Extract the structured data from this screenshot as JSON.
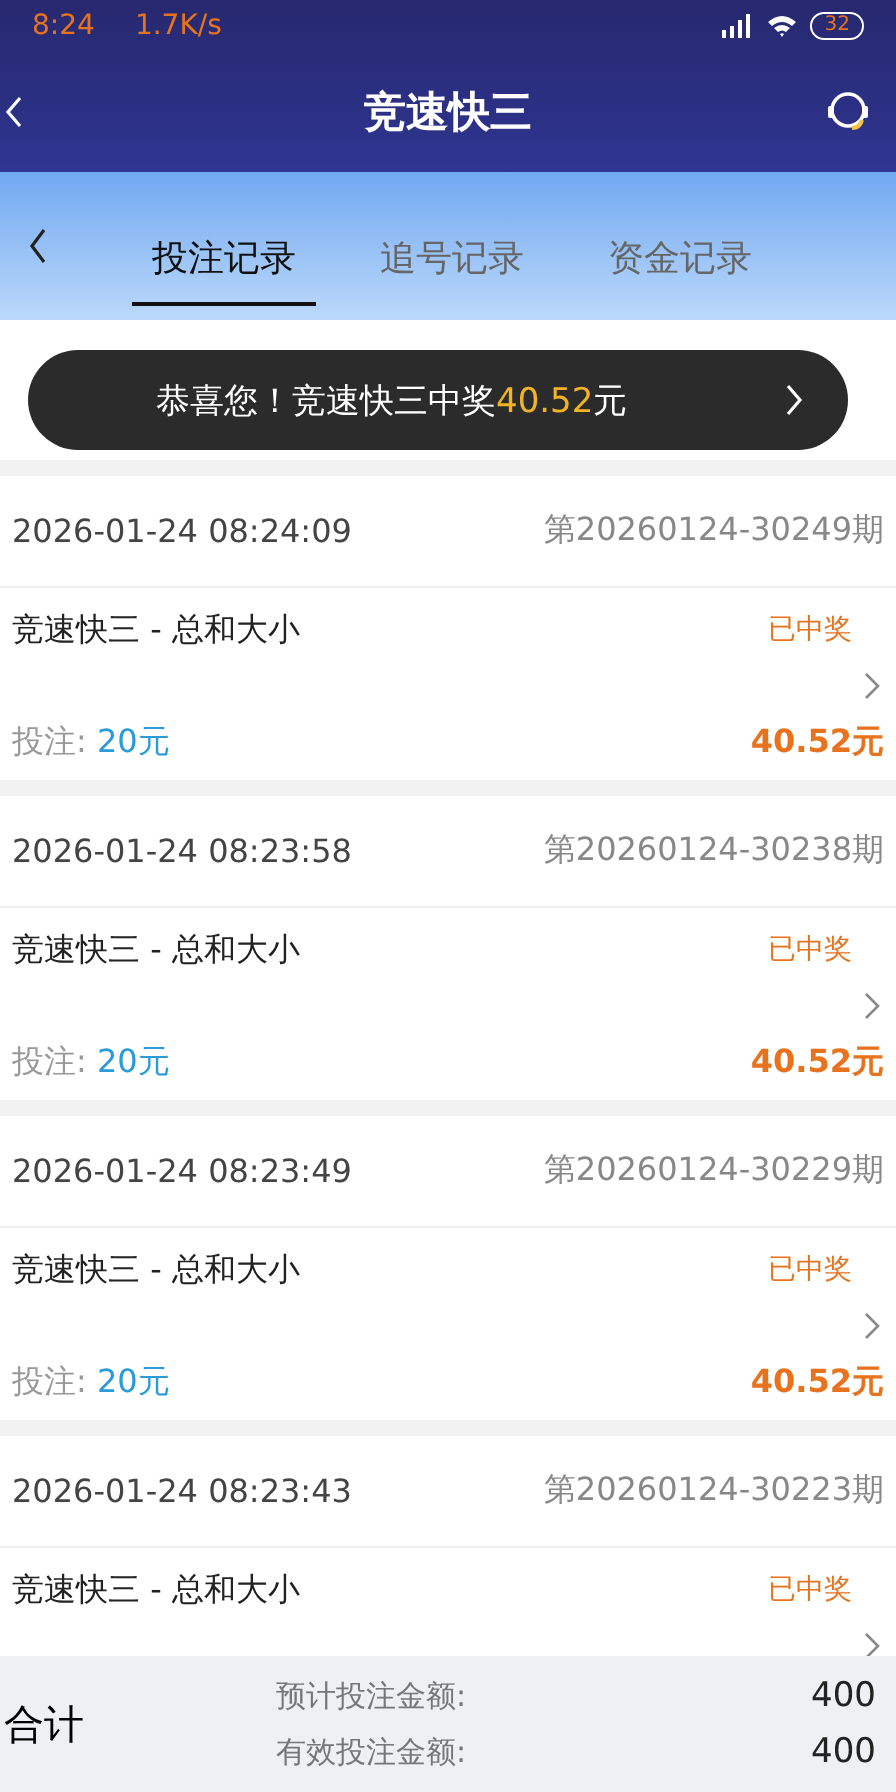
{
  "status_bar": {
    "time": "8:24",
    "speed": "1.7K/s",
    "battery": "32"
  },
  "header": {
    "title": "竞速快三"
  },
  "tabs": [
    {
      "label": "投注记录",
      "selected": true
    },
    {
      "label": "追号记录",
      "selected": false
    },
    {
      "label": "资金记录",
      "selected": false
    }
  ],
  "toast": {
    "prefix": "恭喜您！竞速快三中奖",
    "amount": "40.52",
    "suffix": "元"
  },
  "records": [
    {
      "time": "2026-01-24 08:24:09",
      "issue": "第20260124-30249期",
      "game": "竞速快三 - 总和大小",
      "status": "已中奖",
      "stake_label": "投注:",
      "stake": "20元",
      "prize": "40.52元"
    },
    {
      "time": "2026-01-24 08:23:58",
      "issue": "第20260124-30238期",
      "game": "竞速快三 - 总和大小",
      "status": "已中奖",
      "stake_label": "投注:",
      "stake": "20元",
      "prize": "40.52元"
    },
    {
      "time": "2026-01-24 08:23:49",
      "issue": "第20260124-30229期",
      "game": "竞速快三 - 总和大小",
      "status": "已中奖",
      "stake_label": "投注:",
      "stake": "20元",
      "prize": "40.52元"
    },
    {
      "time": "2026-01-24 08:23:43",
      "issue": "第20260124-30223期",
      "game": "竞速快三 - 总和大小",
      "status": "已中奖"
    }
  ],
  "summary": {
    "label": "合计",
    "rows": [
      {
        "label": "预计投注金额:",
        "value": "400"
      },
      {
        "label": "有效投注金额:",
        "value": "400"
      }
    ]
  }
}
